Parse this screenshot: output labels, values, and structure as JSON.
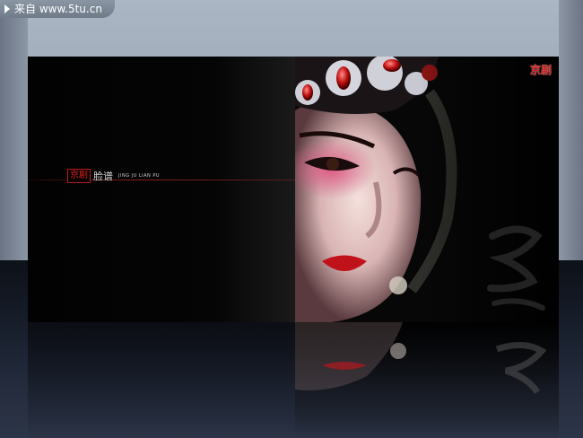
{
  "source_tab": {
    "label": "来自 www.5tu.cn",
    "icon": "play-triangle-icon"
  },
  "book": {
    "left_page": {
      "seal_text": "京剧",
      "title_cn": "脸谱",
      "title_en": "JING JU LIAN PU"
    },
    "right_page": {
      "logo_text": "京剧",
      "photo": "opera-performer-portrait"
    }
  },
  "colors": {
    "accent_red": "#d12424",
    "page_black": "#000000",
    "backdrop": "#9aa6b4"
  }
}
